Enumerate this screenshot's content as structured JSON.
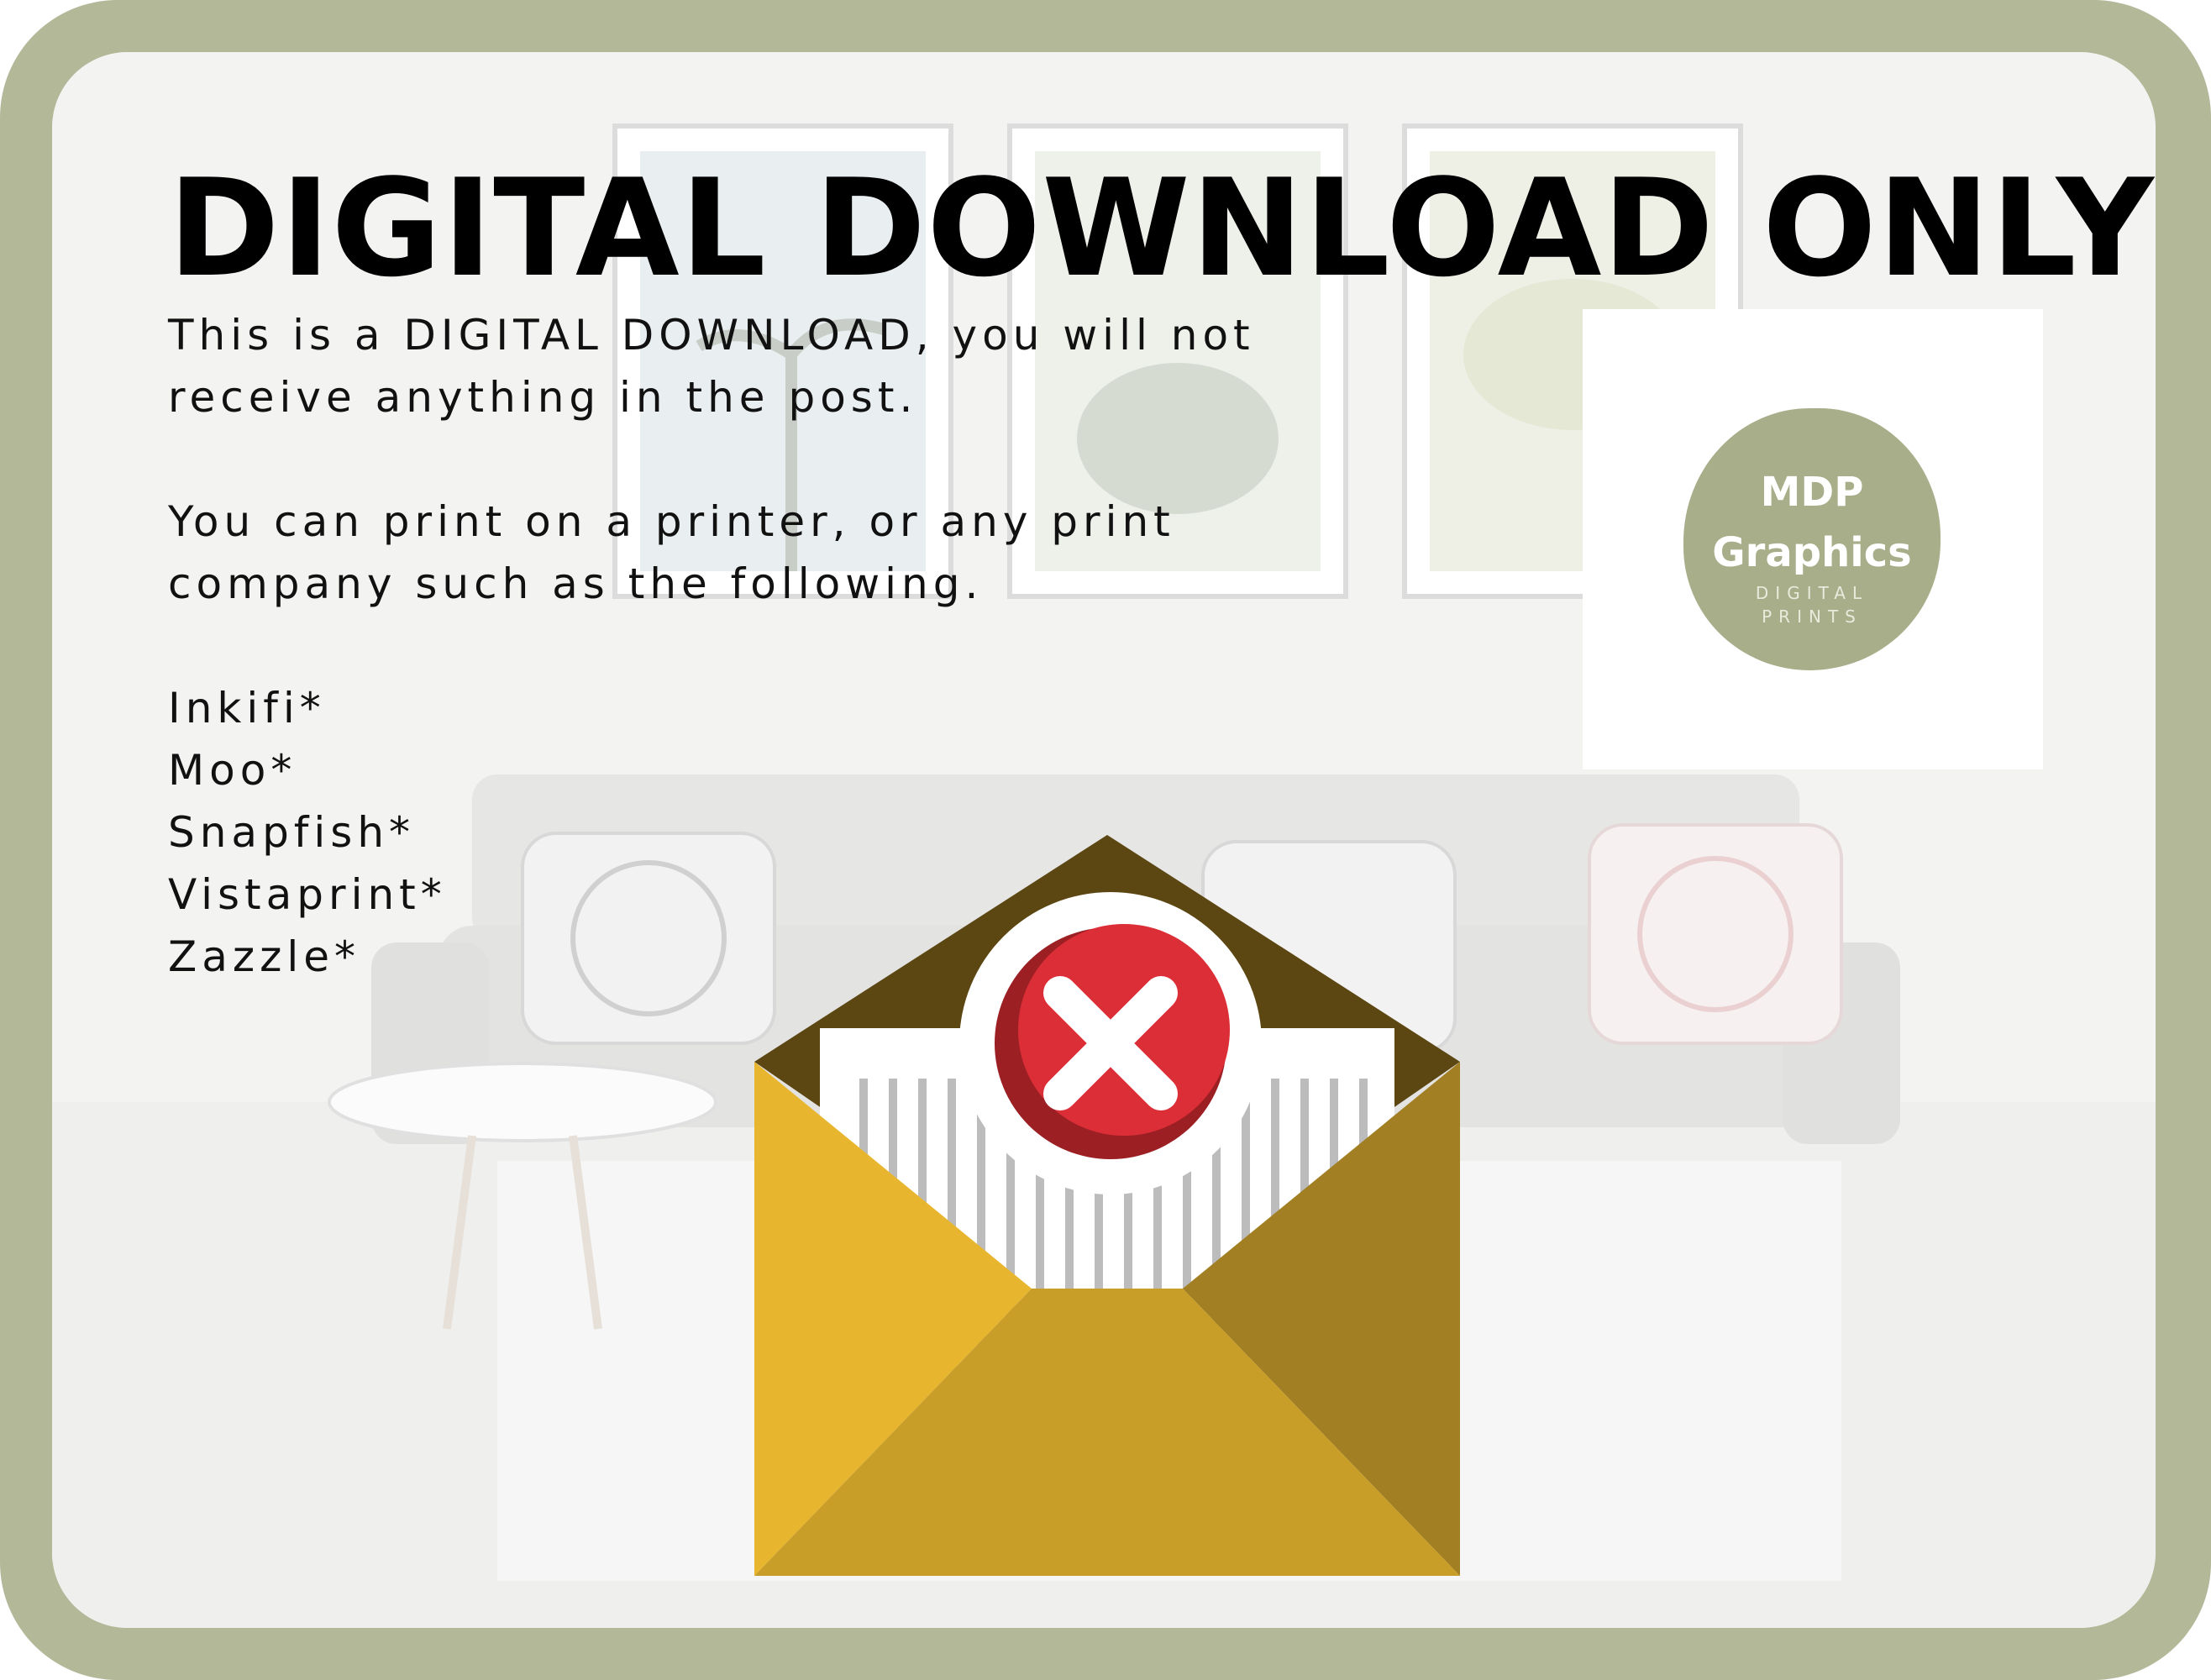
{
  "heading": "DIGITAL DOWNLOAD ONLY",
  "paragraph_1": "This is a DIGITAL DOWNLOAD, you will not receive anything in the post.",
  "paragraph_2": "You can print on a printer, or any print company such as the following.",
  "print_companies": [
    "Inkifi*",
    "Moo*",
    "Snapfish*",
    "Vistaprint*",
    "Zazzle*"
  ],
  "logo": {
    "line_1": "MDP",
    "line_2": "Graphics",
    "tagline": "DIGITAL PRINTS"
  },
  "icons": {
    "envelope": "open-envelope-icon",
    "status": "error-x-icon"
  },
  "colors": {
    "frame": "#b2b898",
    "logo_blob": "#a9ae8a",
    "envelope_front": "#e8b52f",
    "envelope_side": "#a17f22",
    "envelope_inside": "#5c4713",
    "error_red": "#dc2e37"
  }
}
